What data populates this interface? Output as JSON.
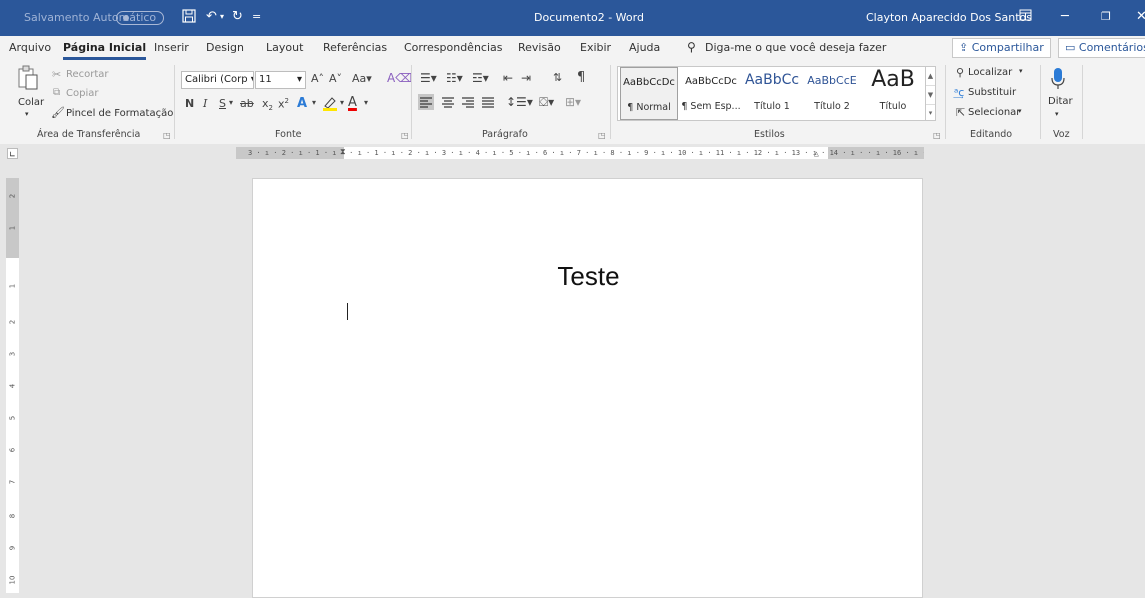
{
  "titlebar": {
    "autosave_label": "Salvamento Automático",
    "document_title": "Documento2  -  Word",
    "user_name": "Clayton Aparecido Dos Santos"
  },
  "tabs": [
    {
      "label": "Arquivo"
    },
    {
      "label": "Página Inicial",
      "active": true
    },
    {
      "label": "Inserir"
    },
    {
      "label": "Design"
    },
    {
      "label": "Layout"
    },
    {
      "label": "Referências"
    },
    {
      "label": "Correspondências"
    },
    {
      "label": "Revisão"
    },
    {
      "label": "Exibir"
    },
    {
      "label": "Ajuda"
    }
  ],
  "search": {
    "placeholder": "Diga-me o que você deseja fazer"
  },
  "share_label": "Compartilhar",
  "comments_label": "Comentários",
  "clipboard": {
    "paste_label": "Colar",
    "cut_label": "Recortar",
    "copy_label": "Copiar",
    "format_painter_label": "Pincel de Formatação",
    "group_label": "Área de Transferência"
  },
  "font": {
    "font_name": "Calibri (Corp",
    "font_size": "11",
    "bold": "N",
    "italic": "I",
    "underline": "S",
    "strike": "ab",
    "subscript": "x",
    "superscript": "x",
    "grow": "A",
    "shrink": "A",
    "change_case": "Aa",
    "font_color": "A",
    "group_label": "Fonte"
  },
  "paragraph": {
    "group_label": "Parágrafo"
  },
  "styles": {
    "items": [
      {
        "preview": "AaBbCcDc",
        "name": "¶ Normal"
      },
      {
        "preview": "AaBbCcDc",
        "name": "¶ Sem Esp..."
      },
      {
        "preview": "AaBbCc",
        "name": "Título 1"
      },
      {
        "preview": "AaBbCcE",
        "name": "Título 2"
      },
      {
        "preview": "AaB",
        "name": "Título"
      }
    ],
    "group_label": "Estilos"
  },
  "editing": {
    "find_label": "Localizar",
    "replace_label": "Substituir",
    "select_label": "Selecionar",
    "group_label": "Editando"
  },
  "voice": {
    "dictate_label": "Ditar",
    "group_label": "Voz"
  },
  "ruler": {
    "text": "3 · ı · 2 · ı · 1 · ı ·    · ı · 1 · ı · 2 · ı · 3 · ı · 4 · ı · 5 · ı · 6 · ı · 7 · ı · 8 · ı · 9 · ı · 10 · ı · 11 · ı · 12 · ı · 13 · ı · 14 · ı ·    · ı · 16 · ı · 17 · ı ·",
    "vertical_numbers": [
      "2",
      "1",
      "1",
      "2",
      "3",
      "4",
      "5",
      "6",
      "7",
      "8",
      "9",
      "10"
    ]
  },
  "document": {
    "content": "Teste"
  },
  "colors": {
    "accent": "#2b579a",
    "ribbon_bg": "#f3f3f3",
    "canvas_bg": "#e6e6e6"
  }
}
